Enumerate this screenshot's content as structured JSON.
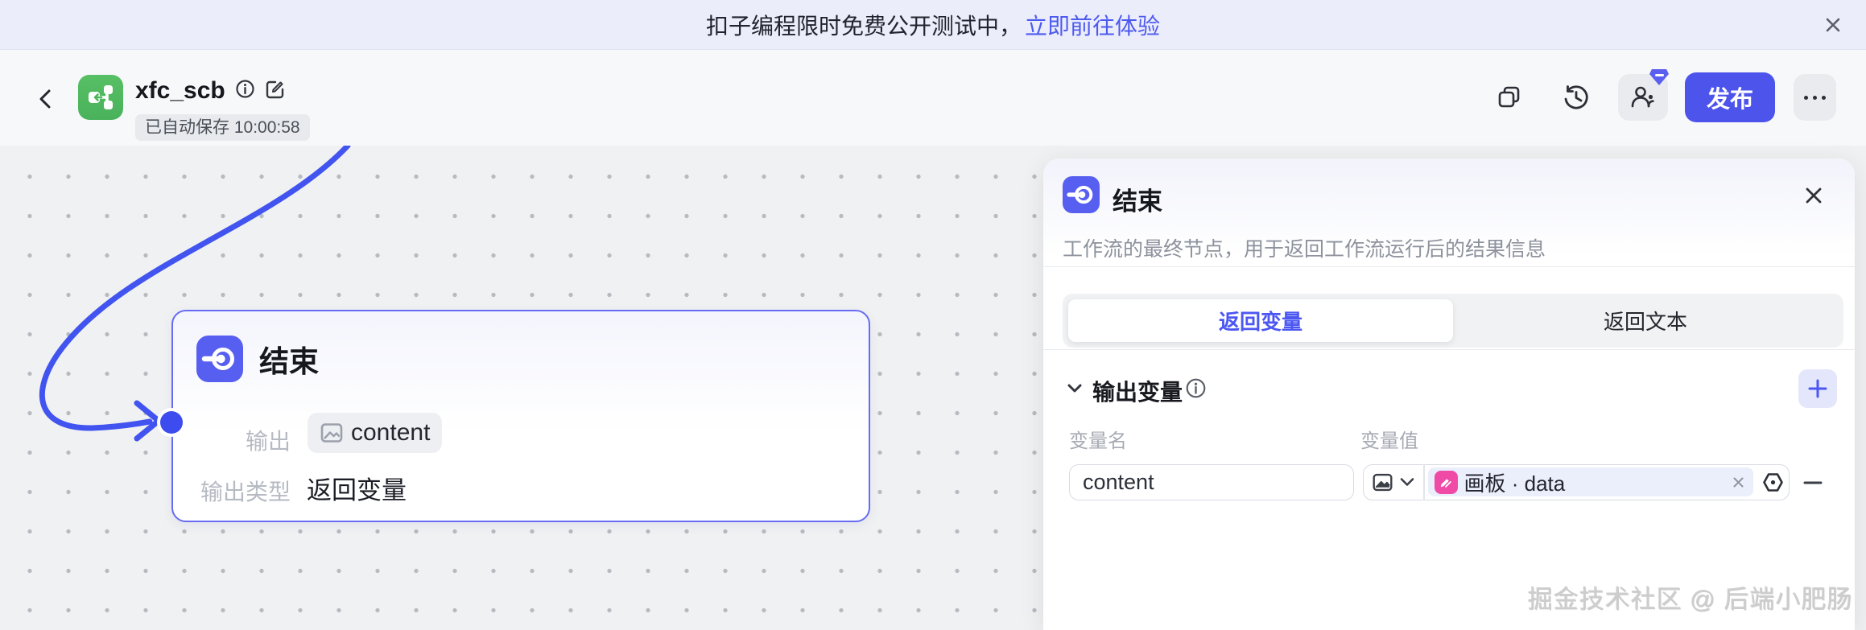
{
  "banner": {
    "text": "扣子编程限时免费公开测试中，",
    "link_label": "立即前往体验"
  },
  "header": {
    "title": "xfc_scb",
    "autosave": "已自动保存 10:00:58",
    "publish_label": "发布"
  },
  "canvas": {
    "node": {
      "title": "结束",
      "output_label": "输出",
      "output_tag": "content",
      "output_type_label": "输出类型",
      "output_type_value": "返回变量"
    }
  },
  "panel": {
    "title": "结束",
    "description": "工作流的最终节点，用于返回工作流运行后的结果信息",
    "tabs": [
      {
        "label": "返回变量",
        "active": true
      },
      {
        "label": "返回文本",
        "active": false
      }
    ],
    "section": {
      "title": "输出变量",
      "col_name": "变量名",
      "col_value": "变量值",
      "row": {
        "name": "content",
        "value_ref": "画板 · data"
      }
    }
  },
  "watermark": "掘金技术社区 @ 后端小肥肠",
  "colors": {
    "accent_indigo": "#575ff0",
    "publish_button": "#4c54ec",
    "link_blue": "#4d5af0",
    "app_icon_green": "#4eb75e",
    "ref_icon_pink": "#ef4ba6",
    "canvas_bg": "#f0f1f2",
    "banner_bg": "#ecedfa"
  }
}
